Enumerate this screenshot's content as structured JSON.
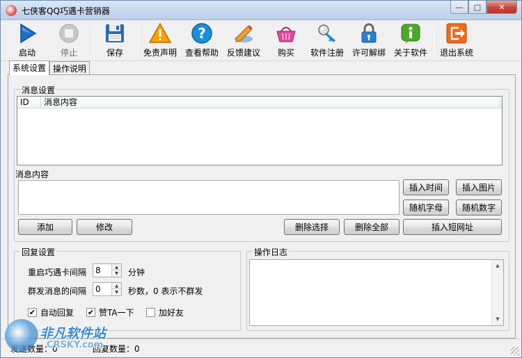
{
  "window": {
    "title": "七侠客QQ巧遇卡营销器",
    "controls": {
      "minimize": "—",
      "maximize": "□",
      "close": "✕"
    }
  },
  "toolbar": {
    "start": {
      "label": "启动",
      "icon": "play-icon",
      "color": "#1f6fc4"
    },
    "stop": {
      "label": "停止",
      "icon": "stop-icon"
    },
    "save": {
      "label": "保存",
      "icon": "floppy-disk-icon"
    },
    "disclaimer": {
      "label": "免责声明",
      "icon": "warning-icon",
      "color": "#f08c00"
    },
    "help": {
      "label": "查看帮助",
      "icon": "help-icon",
      "color": "#1a8fd8"
    },
    "feedback": {
      "label": "反馈建议",
      "icon": "pen-icon"
    },
    "buy": {
      "label": "购买",
      "icon": "basket-icon",
      "color": "#d6308e"
    },
    "register": {
      "label": "软件注册",
      "icon": "key-icon"
    },
    "unbind": {
      "label": "许可解绑",
      "icon": "lock-icon"
    },
    "about": {
      "label": "关于软件",
      "icon": "info-icon",
      "color": "#4ca82c"
    },
    "exit": {
      "label": "退出系统",
      "icon": "exit-icon",
      "color": "#f06a1a"
    }
  },
  "tabs": [
    {
      "label": "系统设置"
    },
    {
      "label": "操作说明"
    }
  ],
  "message_settings": {
    "group_title": "消息设置",
    "columns": [
      "ID",
      "消息内容"
    ],
    "rows": [],
    "content_label": "消息内容",
    "content_value": "",
    "buttons": {
      "insert_time": "插入时间",
      "insert_image": "插入图片",
      "random_letter": "随机字母",
      "random_digit": "随机数字",
      "add": "添加",
      "edit": "修改",
      "delete_selected": "删除选择",
      "delete_all": "删除全部",
      "insert_short_url": "插入短网址"
    }
  },
  "reply_settings": {
    "group_title": "回复设置",
    "restart_interval": {
      "label": "重启巧遇卡间隔",
      "value": "8",
      "unit": "分钟"
    },
    "send_interval": {
      "label": "群发消息的间隔",
      "value": "0",
      "unit": "秒数，0 表示不群发"
    },
    "checkboxes": [
      {
        "label": "自动回复",
        "checked": true
      },
      {
        "label": "赞TA一下",
        "checked": true
      },
      {
        "label": "加好友",
        "checked": false
      }
    ]
  },
  "operation_log": {
    "group_title": "操作日志",
    "content": ""
  },
  "statusbar": {
    "sent": "发送数量：0",
    "reply": "回复数量：0"
  },
  "watermark": {
    "brand": "非凡软件站",
    "site": "CRSKY.com"
  }
}
